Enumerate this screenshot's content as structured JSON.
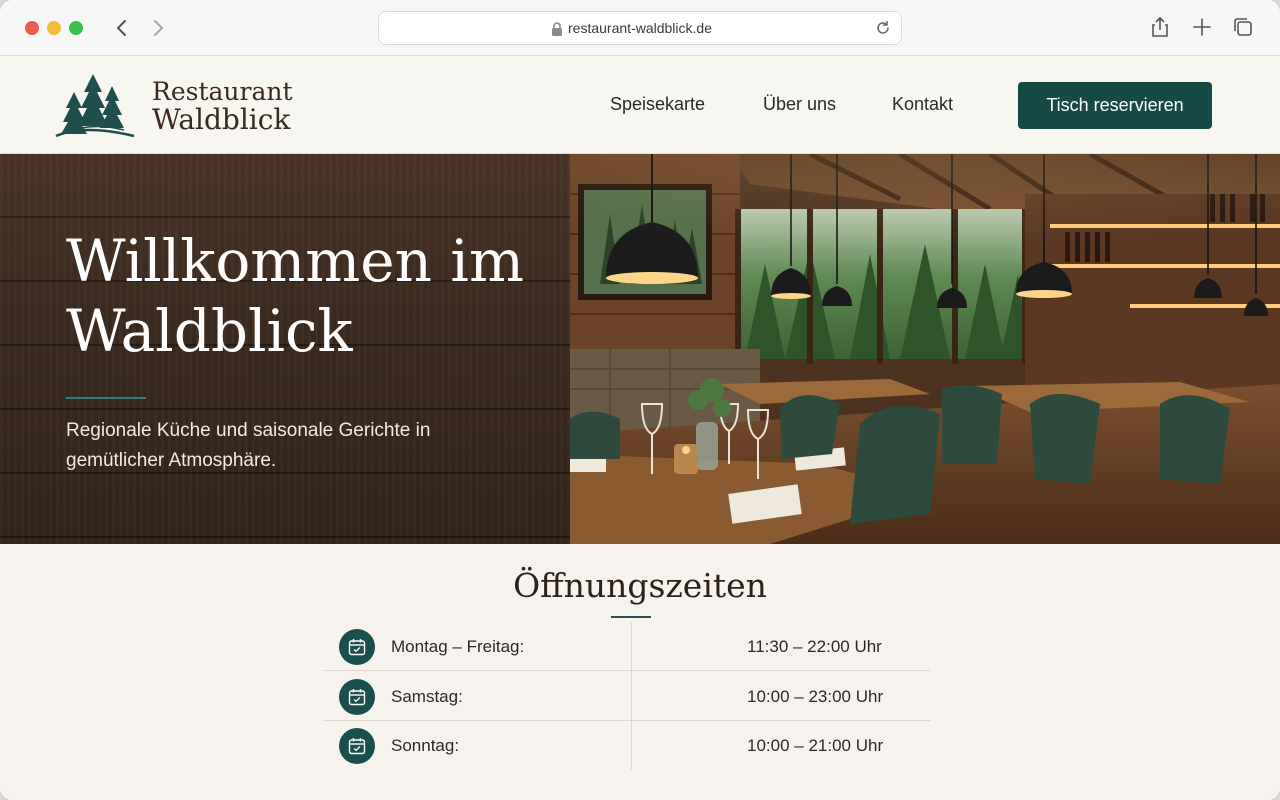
{
  "browser": {
    "url": "restaurant-waldblick.de"
  },
  "header": {
    "logo_line1": "Restaurant",
    "logo_line2": "Waldblick",
    "nav": [
      {
        "label": "Speisekarte"
      },
      {
        "label": "Über uns"
      },
      {
        "label": "Kontakt"
      }
    ],
    "cta_label": "Tisch reservieren"
  },
  "hero": {
    "title": "Willkommen im Waldblick",
    "subtitle": "Regionale Küche und saisonale Gerichte in gemütlicher Atmosphäre."
  },
  "hours": {
    "title": "Öffnungszeiten",
    "rows": [
      {
        "day": "Montag – Freitag:",
        "time": "11:30 – 22:00 Uhr"
      },
      {
        "day": "Samstag:",
        "time": "10:00 – 23:00 Uhr"
      },
      {
        "day": "Sonntag:",
        "time": "10:00 – 21:00 Uhr"
      }
    ]
  },
  "colors": {
    "brand_green": "#154a47",
    "wood_dark": "#3b2a1f",
    "page_bg": "#f6f3ee"
  },
  "icons": [
    "lock-icon",
    "reload-icon",
    "share-icon",
    "new-tab-icon",
    "tabs-overview-icon",
    "back-icon",
    "forward-icon",
    "fir-trees-logo",
    "calendar-icon"
  ]
}
